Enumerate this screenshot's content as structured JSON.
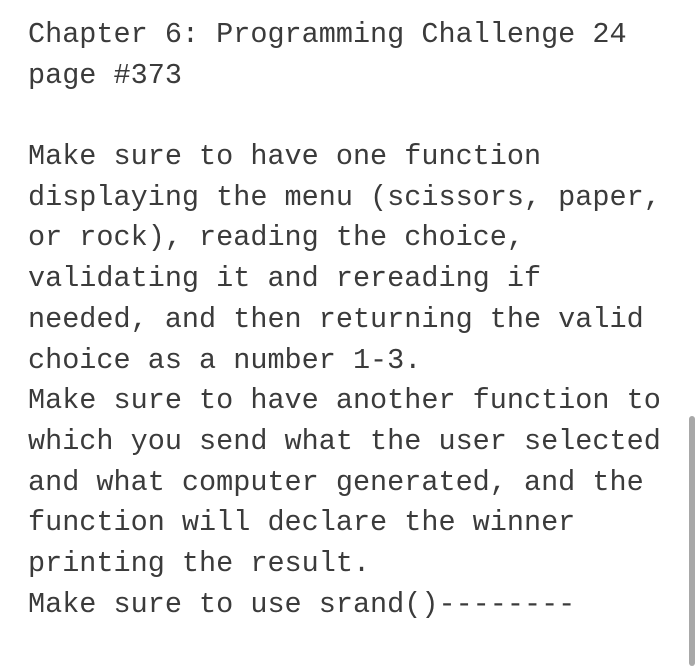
{
  "document": {
    "heading": {
      "lines": [
        "Chapter 6: Programming Challenge 24",
        "page #373"
      ]
    },
    "paragraphs": [
      {
        "lines": [
          "Make sure to have one function",
          "displaying the menu (scissors, paper,",
          "or rock), reading the choice,",
          "validating it and rereading if",
          "needed, and then returning the valid",
          "choice as a number 1-3."
        ]
      },
      {
        "lines": [
          "Make sure to have another function to",
          "which you send what the user selected",
          "and what computer generated, and the",
          "function will declare the winner",
          "printing the result."
        ]
      },
      {
        "lines": [
          "Make sure to use srand()--------"
        ]
      }
    ]
  },
  "colors": {
    "text": "#3b3b3b",
    "background": "#ffffff",
    "scrollbar": "#a8a8a8"
  }
}
